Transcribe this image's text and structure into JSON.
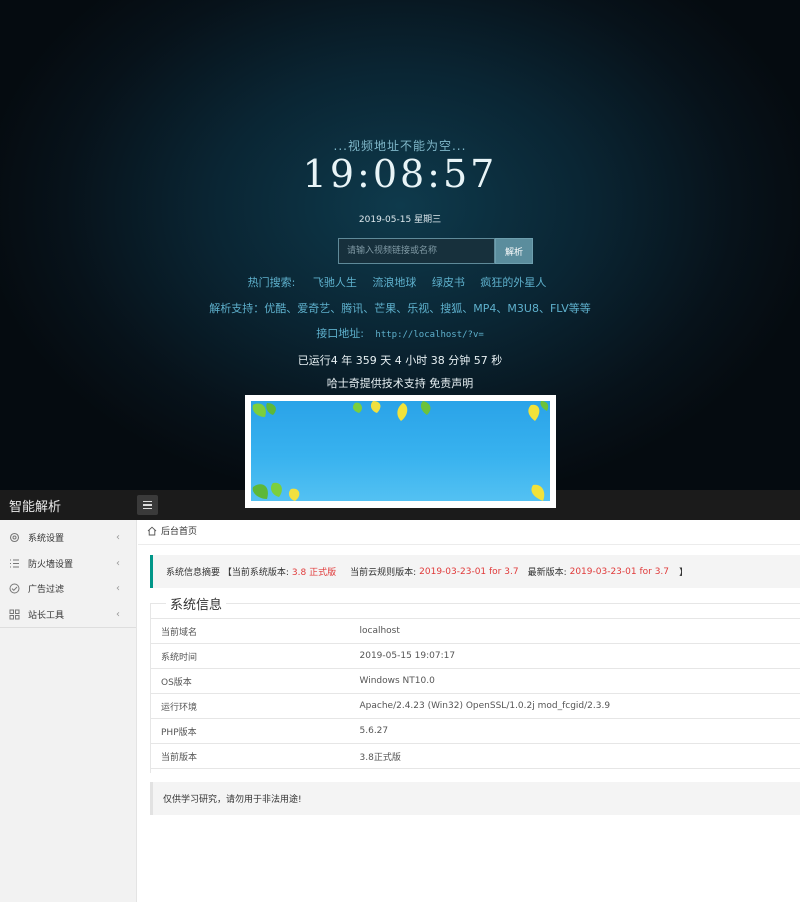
{
  "hero": {
    "tip": "...视频地址不能为空...",
    "clock": "19:08:57",
    "date": "2019-05-15 星期三",
    "search": {
      "placeholder": "请输入视频链接或名称",
      "button": "解析"
    },
    "hot_label": "热门搜索:",
    "hot_links": [
      "飞驰人生",
      "流浪地球",
      "绿皮书",
      "疯狂的外星人"
    ],
    "support": "解析支持：优酷、爱奇艺、腾讯、芒果、乐视、搜狐、MP4、M3U8、FLV等等",
    "api_label": "接口地址:",
    "api_url": "http://localhost/?v=",
    "runtime": "已运行4 年 359 天 4 小时 38 分钟 57 秒",
    "credit_provider": "哈士奇提供技术支持",
    "credit_disclaimer": "免责声明"
  },
  "admin": {
    "logo": "智能解析",
    "sidebar": [
      {
        "label": "系统设置",
        "icon": "gear-icon"
      },
      {
        "label": "防火墙设置",
        "icon": "list-icon"
      },
      {
        "label": "广告过滤",
        "icon": "check-circle-icon"
      },
      {
        "label": "站长工具",
        "icon": "grid-icon"
      }
    ],
    "breadcrumb": "后台首页",
    "notice": {
      "prefix": "系统信息摘要 【当前系统版本:",
      "current_version": "3.8 正式版",
      "cloud_label": "当前云规则版本:",
      "cloud_version": "2019-03-23-01 for 3.7",
      "latest_label": "最新版本:",
      "latest_version": "2019-03-23-01 for 3.7",
      "suffix": "】"
    },
    "section_title": "系统信息",
    "info_rows": [
      {
        "label": "当前域名",
        "value": "localhost"
      },
      {
        "label": "系统时间",
        "value": "2019-05-15 19:07:17"
      },
      {
        "label": "OS版本",
        "value": "Windows NT10.0"
      },
      {
        "label": "运行环境",
        "value": "Apache/2.4.23 (Win32) OpenSSL/1.0.2j mod_fcgid/2.3.9"
      },
      {
        "label": "PHP版本",
        "value": "5.6.27"
      },
      {
        "label": "当前版本",
        "value": "3.8正式版"
      }
    ],
    "warning": "仅供学习研究，请勿用于非法用途!"
  },
  "colors": {
    "accent": "#009688",
    "link": "#5eb0cc",
    "version_red": "#e03a3a",
    "header_bg": "#1b1b1b"
  }
}
